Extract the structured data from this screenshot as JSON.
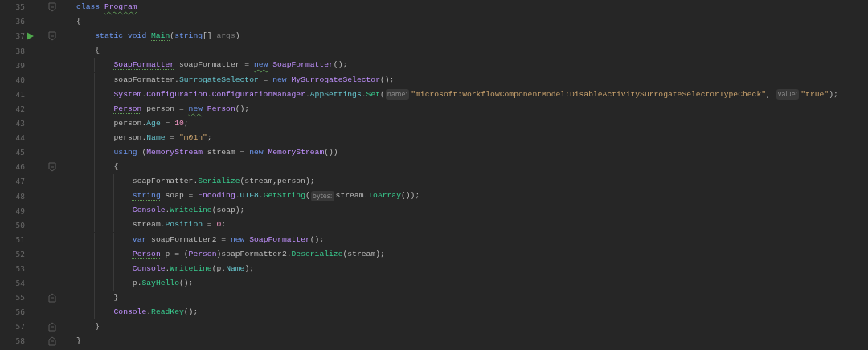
{
  "editor": {
    "lines": [
      {
        "number": "35",
        "run": false,
        "fold_open": true,
        "fold_close": false,
        "tokens": [
          {
            "kind": "kw",
            "text": "class "
          },
          {
            "kind": "type",
            "text": "Program",
            "wavy": true
          }
        ]
      },
      {
        "number": "36",
        "run": false,
        "fold_open": false,
        "fold_close": false,
        "tokens": [
          {
            "kind": "plain",
            "text": "{"
          }
        ],
        "children": [
          {
            "number": "37",
            "run": true,
            "fold_open": true,
            "fold_close": false,
            "tokens": [
              {
                "kind": "kw",
                "text": "static void "
              },
              {
                "kind": "method",
                "text": "Main",
                "dotted": true
              },
              {
                "kind": "plain",
                "text": "("
              },
              {
                "kind": "kw",
                "text": "string"
              },
              {
                "kind": "plain",
                "text": "[] "
              },
              {
                "kind": "param",
                "text": "args"
              },
              {
                "kind": "plain",
                "text": ")"
              }
            ]
          },
          {
            "number": "38",
            "run": false,
            "fold_open": false,
            "fold_close": false,
            "tokens": [
              {
                "kind": "plain",
                "text": "{"
              }
            ],
            "children": [
              {
                "number": "39",
                "run": false,
                "fold_open": false,
                "fold_close": false,
                "tokens": [
                  {
                    "kind": "type",
                    "text": "SoapFormatter",
                    "dotted": true
                  },
                  {
                    "kind": "plain",
                    "text": " soapFormatter = "
                  },
                  {
                    "kind": "kw",
                    "text": "new",
                    "wavy": true
                  },
                  {
                    "kind": "type",
                    "text": " SoapFormatter"
                  },
                  {
                    "kind": "plain",
                    "text": "();"
                  }
                ]
              },
              {
                "number": "40",
                "run": false,
                "fold_open": false,
                "fold_close": false,
                "tokens": [
                  {
                    "kind": "plain",
                    "text": "soapFormatter."
                  },
                  {
                    "kind": "prop",
                    "text": "SurrogateSelector"
                  },
                  {
                    "kind": "plain",
                    "text": " = "
                  },
                  {
                    "kind": "kw",
                    "text": "new "
                  },
                  {
                    "kind": "type",
                    "text": "MySurrogateSelector"
                  },
                  {
                    "kind": "plain",
                    "text": "();"
                  }
                ]
              },
              {
                "number": "41",
                "run": false,
                "fold_open": false,
                "fold_close": false,
                "tokens": [
                  {
                    "kind": "type",
                    "text": "System"
                  },
                  {
                    "kind": "plain",
                    "text": "."
                  },
                  {
                    "kind": "type",
                    "text": "Configuration"
                  },
                  {
                    "kind": "plain",
                    "text": "."
                  },
                  {
                    "kind": "type",
                    "text": "ConfigurationManager"
                  },
                  {
                    "kind": "plain",
                    "text": "."
                  },
                  {
                    "kind": "prop",
                    "text": "AppSettings"
                  },
                  {
                    "kind": "plain",
                    "text": "."
                  },
                  {
                    "kind": "method",
                    "text": "Set"
                  },
                  {
                    "kind": "plain",
                    "text": "("
                  },
                  {
                    "kind": "hint",
                    "text": "name:"
                  },
                  {
                    "kind": "str",
                    "text": "\"microsoft:WorkflowComponentModel:DisableActivitySurrogateSelectorTypeCheck\""
                  },
                  {
                    "kind": "plain",
                    "text": ", "
                  },
                  {
                    "kind": "hint",
                    "text": "value:"
                  },
                  {
                    "kind": "str",
                    "text": "\"true\""
                  },
                  {
                    "kind": "plain",
                    "text": ");"
                  }
                ]
              },
              {
                "number": "42",
                "run": false,
                "fold_open": false,
                "fold_close": false,
                "tokens": [
                  {
                    "kind": "type",
                    "text": "Person",
                    "dotted": true
                  },
                  {
                    "kind": "plain",
                    "text": " person = "
                  },
                  {
                    "kind": "kw",
                    "text": "new",
                    "wavy": true
                  },
                  {
                    "kind": "type",
                    "text": " Person"
                  },
                  {
                    "kind": "plain",
                    "text": "();"
                  }
                ]
              },
              {
                "number": "43",
                "run": false,
                "fold_open": false,
                "fold_close": false,
                "tokens": [
                  {
                    "kind": "plain",
                    "text": "person."
                  },
                  {
                    "kind": "prop",
                    "text": "Age"
                  },
                  {
                    "kind": "plain",
                    "text": " = "
                  },
                  {
                    "kind": "num",
                    "text": "10"
                  },
                  {
                    "kind": "plain",
                    "text": ";"
                  }
                ]
              },
              {
                "number": "44",
                "run": false,
                "fold_open": false,
                "fold_close": false,
                "tokens": [
                  {
                    "kind": "plain",
                    "text": "person."
                  },
                  {
                    "kind": "prop",
                    "text": "Name"
                  },
                  {
                    "kind": "plain",
                    "text": " = "
                  },
                  {
                    "kind": "str",
                    "text": "\"m01n\""
                  },
                  {
                    "kind": "plain",
                    "text": ";"
                  }
                ]
              },
              {
                "number": "45",
                "run": false,
                "fold_open": false,
                "fold_close": false,
                "tokens": [
                  {
                    "kind": "kw",
                    "text": "using"
                  },
                  {
                    "kind": "plain",
                    "text": " ("
                  },
                  {
                    "kind": "type",
                    "text": "MemoryStream",
                    "dotted": true
                  },
                  {
                    "kind": "plain",
                    "text": " stream = "
                  },
                  {
                    "kind": "kw",
                    "text": "new "
                  },
                  {
                    "kind": "type",
                    "text": "MemoryStream"
                  },
                  {
                    "kind": "plain",
                    "text": "())"
                  }
                ]
              },
              {
                "number": "46",
                "run": false,
                "fold_open": true,
                "fold_close": false,
                "tokens": [
                  {
                    "kind": "plain",
                    "text": "{"
                  }
                ],
                "children": [
                  {
                    "number": "47",
                    "run": false,
                    "fold_open": false,
                    "fold_close": false,
                    "tokens": [
                      {
                        "kind": "plain",
                        "text": "soapFormatter."
                      },
                      {
                        "kind": "method",
                        "text": "Serialize"
                      },
                      {
                        "kind": "plain",
                        "text": "(stream,person);"
                      }
                    ]
                  },
                  {
                    "number": "48",
                    "run": false,
                    "fold_open": false,
                    "fold_close": false,
                    "tokens": [
                      {
                        "kind": "kw",
                        "text": "string",
                        "dotted": true
                      },
                      {
                        "kind": "plain",
                        "text": " soap = "
                      },
                      {
                        "kind": "type",
                        "text": "Encoding"
                      },
                      {
                        "kind": "plain",
                        "text": "."
                      },
                      {
                        "kind": "prop",
                        "text": "UTF8"
                      },
                      {
                        "kind": "plain",
                        "text": "."
                      },
                      {
                        "kind": "method",
                        "text": "GetString"
                      },
                      {
                        "kind": "plain",
                        "text": "("
                      },
                      {
                        "kind": "hint",
                        "text": "bytes:"
                      },
                      {
                        "kind": "plain",
                        "text": "stream."
                      },
                      {
                        "kind": "method",
                        "text": "ToArray"
                      },
                      {
                        "kind": "plain",
                        "text": "());"
                      }
                    ]
                  },
                  {
                    "number": "49",
                    "run": false,
                    "fold_open": false,
                    "fold_close": false,
                    "tokens": [
                      {
                        "kind": "type",
                        "text": "Console"
                      },
                      {
                        "kind": "plain",
                        "text": "."
                      },
                      {
                        "kind": "method",
                        "text": "WriteLine"
                      },
                      {
                        "kind": "plain",
                        "text": "(soap);"
                      }
                    ]
                  },
                  {
                    "number": "50",
                    "run": false,
                    "fold_open": false,
                    "fold_close": false,
                    "tokens": [
                      {
                        "kind": "plain",
                        "text": "stream."
                      },
                      {
                        "kind": "prop",
                        "text": "Position"
                      },
                      {
                        "kind": "plain",
                        "text": " = "
                      },
                      {
                        "kind": "num",
                        "text": "0"
                      },
                      {
                        "kind": "plain",
                        "text": ";"
                      }
                    ]
                  },
                  {
                    "number": "51",
                    "run": false,
                    "fold_open": false,
                    "fold_close": false,
                    "tokens": [
                      {
                        "kind": "kw",
                        "text": "var"
                      },
                      {
                        "kind": "plain",
                        "text": " soapFormatter2 = "
                      },
                      {
                        "kind": "kw",
                        "text": "new "
                      },
                      {
                        "kind": "type",
                        "text": "SoapFormatter"
                      },
                      {
                        "kind": "plain",
                        "text": "();"
                      }
                    ]
                  },
                  {
                    "number": "52",
                    "run": false,
                    "fold_open": false,
                    "fold_close": false,
                    "tokens": [
                      {
                        "kind": "type",
                        "text": "Person",
                        "dotted": true
                      },
                      {
                        "kind": "plain",
                        "text": " p = ("
                      },
                      {
                        "kind": "type",
                        "text": "Person"
                      },
                      {
                        "kind": "plain",
                        "text": ")soapFormatter2."
                      },
                      {
                        "kind": "method",
                        "text": "Deserialize"
                      },
                      {
                        "kind": "plain",
                        "text": "(stream);"
                      }
                    ]
                  },
                  {
                    "number": "53",
                    "run": false,
                    "fold_open": false,
                    "fold_close": false,
                    "tokens": [
                      {
                        "kind": "type",
                        "text": "Console"
                      },
                      {
                        "kind": "plain",
                        "text": "."
                      },
                      {
                        "kind": "method",
                        "text": "WriteLine"
                      },
                      {
                        "kind": "plain",
                        "text": "(p."
                      },
                      {
                        "kind": "prop",
                        "text": "Name"
                      },
                      {
                        "kind": "plain",
                        "text": ");"
                      }
                    ]
                  },
                  {
                    "number": "54",
                    "run": false,
                    "fold_open": false,
                    "fold_close": false,
                    "tokens": [
                      {
                        "kind": "plain",
                        "text": "p."
                      },
                      {
                        "kind": "method",
                        "text": "SayHello"
                      },
                      {
                        "kind": "plain",
                        "text": "();"
                      }
                    ]
                  }
                ]
              },
              {
                "number": "55",
                "run": false,
                "fold_open": false,
                "fold_close": true,
                "tokens": [
                  {
                    "kind": "plain",
                    "text": "}"
                  }
                ]
              },
              {
                "number": "56",
                "run": false,
                "fold_open": false,
                "fold_close": false,
                "tokens": [
                  {
                    "kind": "type",
                    "text": "Console"
                  },
                  {
                    "kind": "plain",
                    "text": "."
                  },
                  {
                    "kind": "method",
                    "text": "ReadKey"
                  },
                  {
                    "kind": "plain",
                    "text": "();"
                  }
                ]
              }
            ]
          },
          {
            "number": "57",
            "run": false,
            "fold_open": false,
            "fold_close": true,
            "tokens": [
              {
                "kind": "plain",
                "text": "}"
              }
            ]
          }
        ]
      },
      {
        "number": "58",
        "run": false,
        "fold_open": false,
        "fold_close": true,
        "tokens": [
          {
            "kind": "plain",
            "text": "}"
          }
        ]
      }
    ]
  }
}
